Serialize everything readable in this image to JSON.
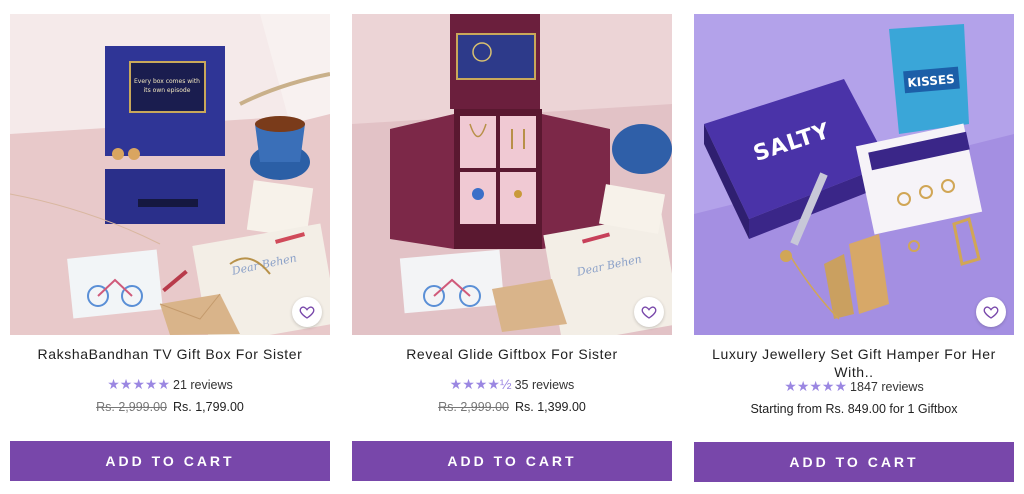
{
  "products": [
    {
      "title": "RakshaBandhan TV Gift Box For Sister",
      "stars": "★★★★★",
      "reviews": "21 reviews",
      "old_price": "Rs. 2,999.00",
      "price": "Rs. 1,799.00",
      "box_line1": "Every box comes with",
      "box_line2": "its own episode",
      "card_text": "Dear Behen",
      "button": "ADD TO CART"
    },
    {
      "title": "Reveal Glide Giftbox For Sister",
      "stars": "★★★★½",
      "reviews": "35 reviews",
      "old_price": "Rs. 2,999.00",
      "price": "Rs. 1,399.00",
      "card_text": "Dear Behen",
      "button": "ADD TO CART"
    },
    {
      "title": "Luxury Jewellery Set Gift Hamper For Her With..",
      "stars": "★★★★★",
      "reviews": "1847 reviews",
      "price_text": "Starting from Rs. 849.00 for 1 Giftbox",
      "brand": "SALTY",
      "snack": "KISSES",
      "button": "ADD TO CART"
    }
  ],
  "colors": {
    "button": "#7847aa",
    "stars": "#9b87e2"
  }
}
